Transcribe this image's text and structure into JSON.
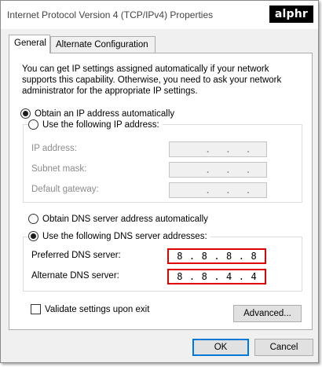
{
  "window": {
    "title": "Internet Protocol Version 4 (TCP/IPv4) Properties"
  },
  "logo": {
    "text": "alphr"
  },
  "tabs": [
    {
      "label": "General",
      "active": true
    },
    {
      "label": "Alternate Configuration",
      "active": false
    }
  ],
  "description": "You can get IP settings assigned automatically if your network supports this capability. Otherwise, you need to ask your network administrator for the appropriate IP settings.",
  "ip": {
    "auto_label": "Obtain an IP address automatically",
    "auto_checked": true,
    "manual_label": "Use the following IP address:",
    "manual_checked": false,
    "fields": [
      {
        "label": "IP address:",
        "value": [
          " ",
          ".",
          ".",
          "."
        ]
      },
      {
        "label": "Subnet mask:",
        "value": [
          " ",
          ".",
          ".",
          "."
        ]
      },
      {
        "label": "Default gateway:",
        "value": [
          " ",
          ".",
          ".",
          "."
        ]
      }
    ]
  },
  "dns": {
    "auto_label": "Obtain DNS server address automatically",
    "auto_checked": false,
    "manual_label": "Use the following DNS server addresses:",
    "manual_checked": true,
    "preferred": {
      "label": "Preferred DNS server:",
      "octets": [
        "8",
        ".",
        "8",
        ".",
        "8",
        ".",
        "8"
      ]
    },
    "alternate": {
      "label": "Alternate DNS server:",
      "octets": [
        "8",
        ".",
        "8",
        ".",
        "4",
        ".",
        "4"
      ]
    }
  },
  "validate": {
    "label": "Validate settings upon exit",
    "checked": false
  },
  "buttons": {
    "advanced": "Advanced...",
    "ok": "OK",
    "cancel": "Cancel"
  },
  "colors": {
    "highlight": "#e00000",
    "accent": "#0078d7"
  }
}
